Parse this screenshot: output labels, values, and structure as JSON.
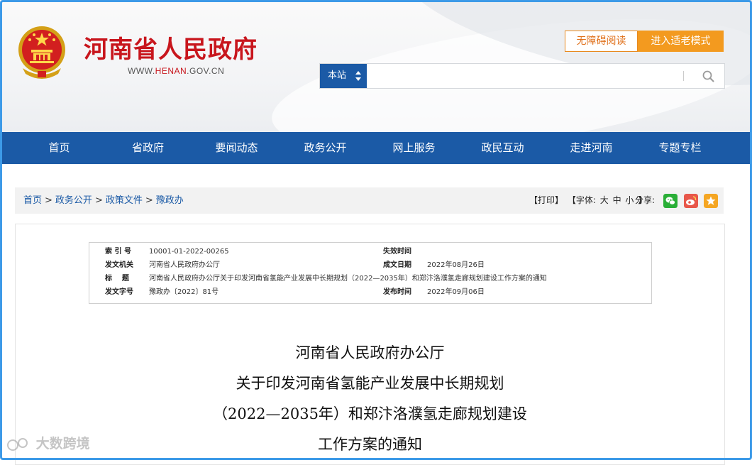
{
  "header": {
    "site_name": "河南省人民政府",
    "url_prefix": "WWW.",
    "url_brand": "HENAN",
    "url_suffix": ".GOV.CN",
    "accessibility_label": "无障碍阅读",
    "elder_mode_label": "进入适老模式",
    "search": {
      "scope": "本站",
      "value": "",
      "placeholder": ""
    }
  },
  "nav": {
    "items": [
      "首页",
      "省政府",
      "要闻动态",
      "政务公开",
      "网上服务",
      "政民互动",
      "走进河南",
      "专题专栏"
    ]
  },
  "breadcrumb": {
    "items": [
      "首页",
      "政务公开",
      "政策文件",
      "豫政办"
    ],
    "separator": ">"
  },
  "tools": {
    "print": "【打印】",
    "font_label": "【字体:",
    "font_large": "大",
    "font_medium": "中",
    "font_small": "小",
    "font_end": "】",
    "share_label": "分享:"
  },
  "meta": {
    "index_label": "索 引 号",
    "index_value": "10001-01-2022-00265",
    "expire_label": "失效时间",
    "expire_value": "",
    "issuer_label": "发文机关",
    "issuer_value": "河南省人民政府办公厅",
    "created_label": "成文日期",
    "created_value": "2022年08月26日",
    "title_label": "标    题",
    "title_value": "河南省人民政府办公厅关于印发河南省氢能产业发展中长期规划（2022—2035年）和郑汴洛濮氢走廊规划建设工作方案的通知",
    "docno_label": "发文字号",
    "docno_value": "豫政办〔2022〕81号",
    "publish_label": "发布时间",
    "publish_value": "2022年09月06日"
  },
  "document": {
    "title_lines": [
      "河南省人民政府办公厅",
      "关于印发河南省氢能产业发展中长期规划",
      "（2022—2035年）和郑汴洛濮氢走廊规划建设",
      "工作方案的通知"
    ]
  },
  "watermark": "大数跨境",
  "colors": {
    "brand_red": "#c8161d",
    "nav_blue": "#1b5aa6",
    "accent_orange": "#f39a1f",
    "frame_blue": "#3d9ae8"
  },
  "icons": {
    "emblem": "national-emblem-icon",
    "search": "search-icon",
    "share": [
      "wechat-icon",
      "weibo-icon",
      "favorite-icon"
    ]
  }
}
